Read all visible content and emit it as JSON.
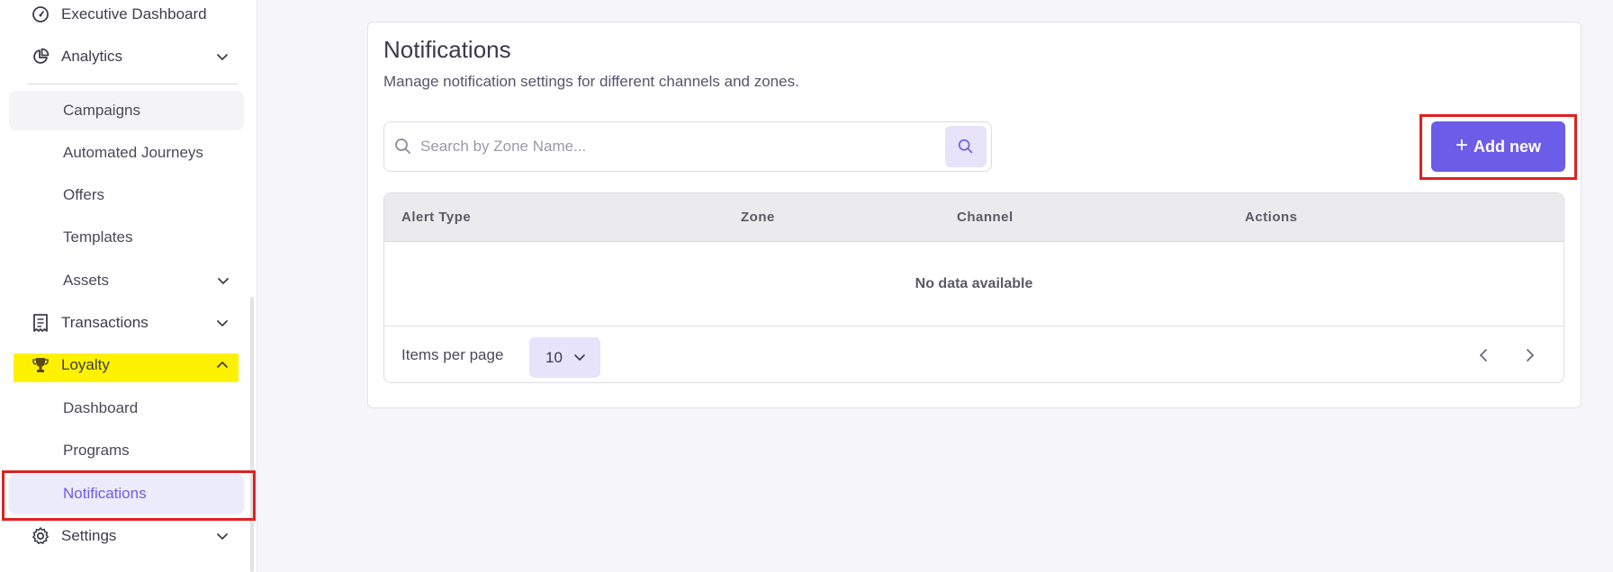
{
  "sidebar": {
    "items": [
      {
        "label": "Executive Dashboard",
        "icon": "gauge-icon"
      },
      {
        "label": "Analytics",
        "icon": "pie-chart-icon"
      },
      {
        "label": "Transactions",
        "icon": "receipt-icon"
      },
      {
        "label": "Loyalty",
        "icon": "trophy-icon"
      },
      {
        "label": "Settings",
        "icon": "gear-icon"
      }
    ],
    "engagement_sub": [
      "Campaigns",
      "Automated Journeys",
      "Offers",
      "Templates",
      "Assets"
    ],
    "loyalty_sub": [
      "Dashboard",
      "Programs",
      "Notifications"
    ]
  },
  "main": {
    "title": "Notifications",
    "subtitle": "Manage notification settings for different channels and zones.",
    "search_placeholder": "Search by Zone Name...",
    "add_button": "Add new",
    "add_button_icon": "+"
  },
  "table": {
    "columns": [
      "Alert Type",
      "Zone",
      "Channel",
      "Actions"
    ],
    "empty_text": "No data available",
    "items_per_page_label": "Items per page",
    "items_per_page_value": "10"
  },
  "colors": {
    "accent": "#6c5ce7",
    "accent_light": "#e6e3fb",
    "highlight": "#fff200",
    "annotation_red": "#e02020"
  }
}
